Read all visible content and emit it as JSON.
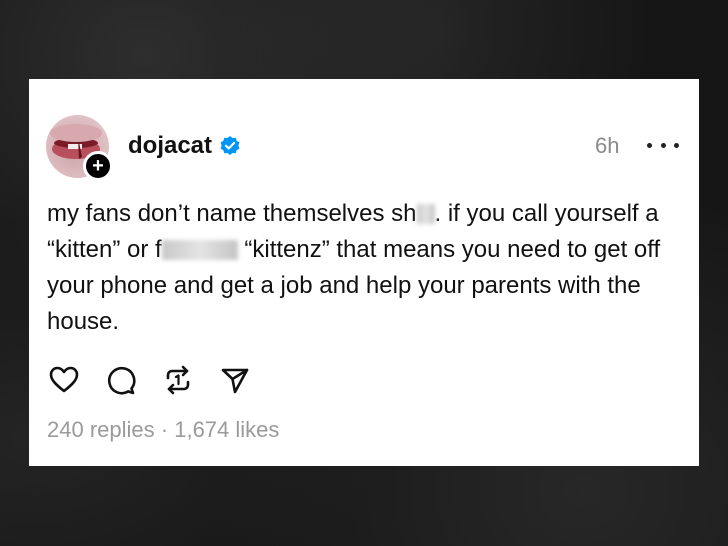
{
  "post": {
    "username": "dojacat",
    "verified": true,
    "timestamp": "6h",
    "text_part1": "my fans don’t name themselves sh",
    "text_part2": ". if you call yourself a “kitten” or f",
    "text_part3": " “kittenz” that means you need to get off your phone and get a job and help your parents with the house.",
    "replies_count": "240 replies",
    "separator": "·",
    "likes_count": "1,674 likes"
  },
  "icons": {
    "follow": "+",
    "verified": "verified-badge-icon",
    "more": "more-horizontal-icon",
    "like": "heart-icon",
    "reply": "comment-icon",
    "repost": "repost-icon",
    "share": "send-icon"
  },
  "colors": {
    "verified_blue": "#0095f6",
    "text": "#111111",
    "muted": "#9a9a9a",
    "card": "#ffffff",
    "background": "#141414"
  }
}
